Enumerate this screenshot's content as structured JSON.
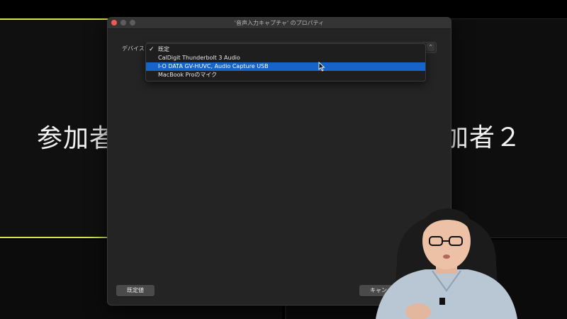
{
  "background": {
    "participant_left": "参加者",
    "participant_right": "加者２",
    "accent_color": "#d7e64b"
  },
  "window": {
    "title": "'音声入力キャプチャ' のプロパティ",
    "device_label": "デバイス",
    "dropdown": {
      "options": [
        {
          "label": "既定",
          "checked": true
        },
        {
          "label": "CalDigit Thunderbolt 3 Audio",
          "checked": false
        },
        {
          "label": "I-O DATA GV-HUVC, Audio Capture USB",
          "highlighted": true
        },
        {
          "label": "MacBook Proのマイク",
          "checked": false
        }
      ]
    },
    "buttons": {
      "defaults": "既定値",
      "cancel": "キャン"
    },
    "highlight_color": "#1664c8"
  }
}
